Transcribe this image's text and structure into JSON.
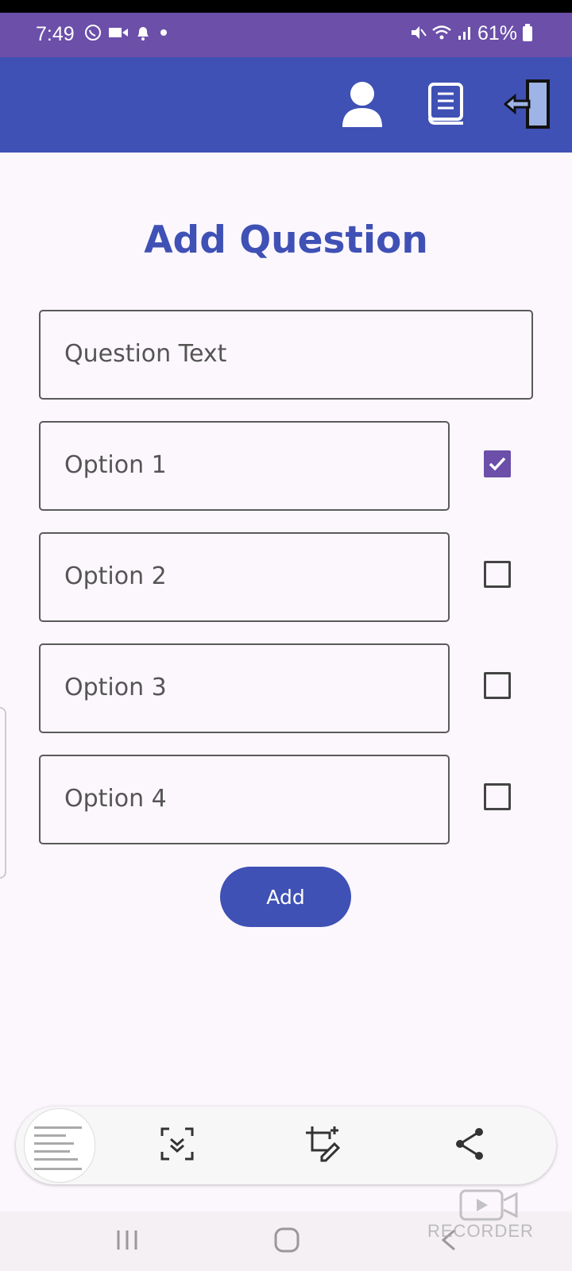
{
  "status_bar": {
    "time": "7:49",
    "battery": "61%",
    "left_icons": [
      "whatsapp-icon",
      "video-icon",
      "bell-icon",
      "dot-icon"
    ],
    "right_icons": [
      "mute-icon",
      "wifi-icon",
      "signal-icon",
      "battery-icon"
    ]
  },
  "app_bar": {
    "color": "#3f51b5",
    "actions": [
      "profile-icon",
      "book-icon",
      "logout-icon"
    ]
  },
  "page": {
    "title": "Add Question"
  },
  "form": {
    "question_placeholder": "Question Text",
    "options": [
      {
        "placeholder": "Option 1",
        "correct": true
      },
      {
        "placeholder": "Option 2",
        "correct": false
      },
      {
        "placeholder": "Option 3",
        "correct": false
      },
      {
        "placeholder": "Option 4",
        "correct": false
      }
    ],
    "add_label": "Add"
  },
  "capture_toolbar": {
    "actions": [
      "thumbnail",
      "scroll-capture-icon",
      "crop-edit-icon",
      "share-icon"
    ]
  },
  "nav_bar": {
    "buttons": [
      "recents-icon",
      "home-icon",
      "back-icon"
    ]
  },
  "watermark": {
    "text": "RECORDER"
  },
  "colors": {
    "primary": "#3f51b5",
    "status_bar": "#6b4fa9",
    "checkbox_checked": "#6b4fa9",
    "background": "#fcf7fd"
  }
}
